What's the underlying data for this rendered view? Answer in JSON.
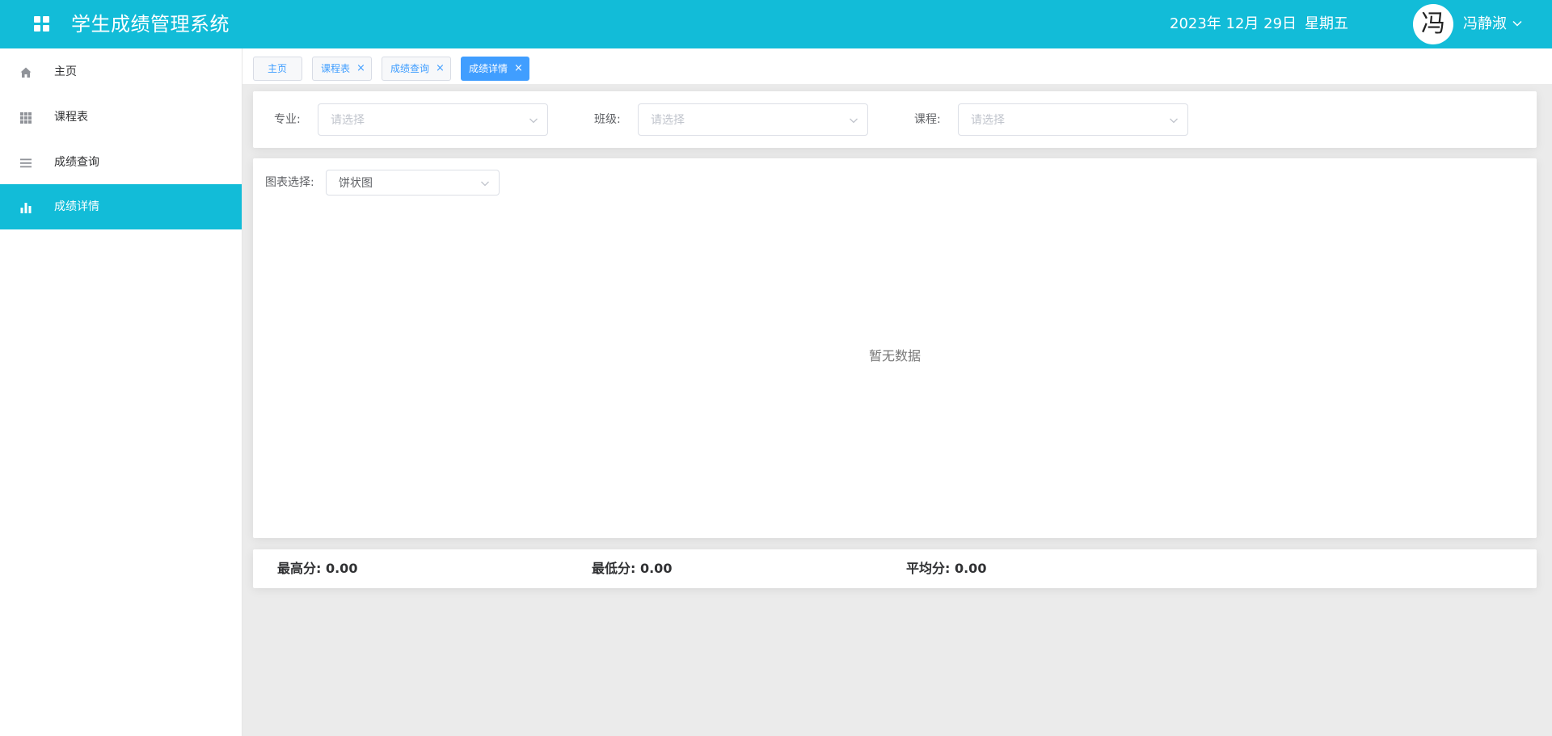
{
  "header": {
    "title": "学生成绩管理系统",
    "date": "2023年 12月 29日",
    "weekday": "星期五",
    "avatar_text": "冯",
    "username": "冯静淑",
    "bg_color": "#12bcd8"
  },
  "sidebar": {
    "items": [
      {
        "label": "主页",
        "icon": "home-icon"
      },
      {
        "label": "课程表",
        "icon": "grid-icon"
      },
      {
        "label": "成绩查询",
        "icon": "list-icon"
      },
      {
        "label": "成绩详情",
        "icon": "bar-chart-icon",
        "active": true
      }
    ]
  },
  "tabs": [
    {
      "label": "主页",
      "closable": false
    },
    {
      "label": "课程表",
      "closable": true
    },
    {
      "label": "成绩查询",
      "closable": true
    },
    {
      "label": "成绩详情",
      "closable": true,
      "active": true
    }
  ],
  "tab_close_glyph": "×",
  "filters": {
    "major": {
      "label": "专业:",
      "placeholder": "请选择"
    },
    "class": {
      "label": "班级:",
      "placeholder": "请选择"
    },
    "course": {
      "label": "课程:",
      "placeholder": "请选择"
    }
  },
  "chart": {
    "select_label": "图表选择:",
    "selected": "饼状图",
    "empty_text": "暂无数据"
  },
  "stats": {
    "max": "最高分: 0.00",
    "min": "最低分: 0.00",
    "avg": "平均分: 0.00"
  },
  "colors": {
    "accent": "#12bcd8",
    "tab_active": "#409eff"
  }
}
